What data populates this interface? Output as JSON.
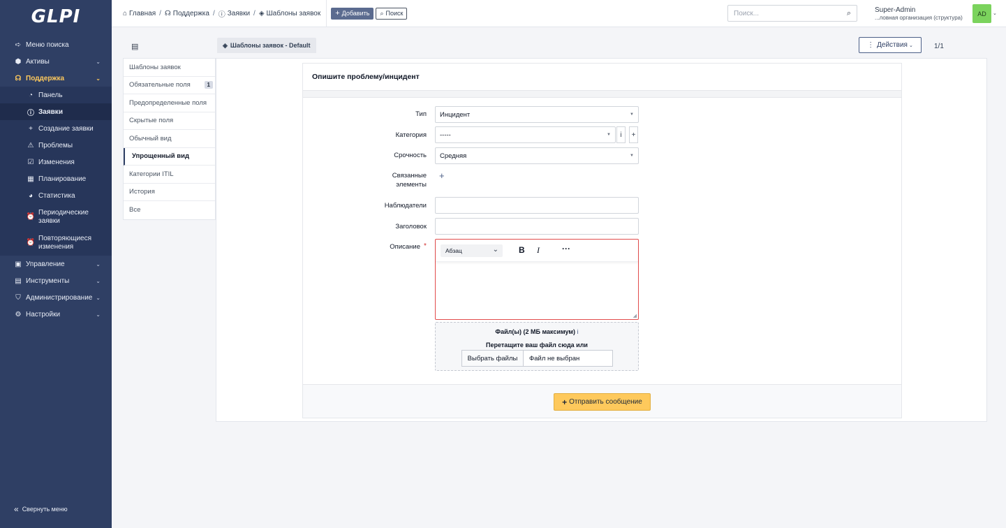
{
  "app": {
    "logo_text": "GLPI",
    "collapse_label": "Свернуть меню"
  },
  "sidebar": {
    "items": [
      {
        "label": "Меню поиска",
        "icon": "arrow-right-icon"
      },
      {
        "label": "Активы",
        "icon": "box-icon"
      },
      {
        "label": "Поддержка",
        "icon": "headset-icon"
      },
      {
        "label": "Управление",
        "icon": "wallet-icon"
      },
      {
        "label": "Инструменты",
        "icon": "briefcase-icon"
      },
      {
        "label": "Администрирование",
        "icon": "shield-icon"
      },
      {
        "label": "Настройки",
        "icon": "gear-icon"
      }
    ],
    "support_sub": [
      {
        "label": "Панель",
        "icon": "dashboard-icon"
      },
      {
        "label": "Заявки",
        "icon": "alert-circle-icon"
      },
      {
        "label": "Создание заявки",
        "icon": "plus-icon"
      },
      {
        "label": "Проблемы",
        "icon": "warning-icon"
      },
      {
        "label": "Изменения",
        "icon": "clipboard-check-icon"
      },
      {
        "label": "Планирование",
        "icon": "calendar-icon"
      },
      {
        "label": "Статистика",
        "icon": "pie-chart-icon"
      },
      {
        "label": "Периодические заявки",
        "icon": "alarm-icon"
      },
      {
        "label": "Повторяющиеся изменения",
        "icon": "alarm-icon"
      }
    ]
  },
  "header": {
    "breadcrumb": [
      "Главная",
      "Поддержка",
      "Заявки",
      "Шаблоны заявок"
    ],
    "add_label": "Добавить",
    "search_label": "Поиск",
    "search_placeholder": "Поиск...",
    "user_name": "Super-Admin",
    "user_org": "...ловная организация (структура)",
    "avatar_initials": "AD"
  },
  "page": {
    "tab_title": "Шаблоны заявок - Default",
    "actions_label": "Действия",
    "pager": "1/1"
  },
  "tabs": [
    {
      "label": "Шаблоны заявок"
    },
    {
      "label": "Обязательные поля",
      "badge": "1"
    },
    {
      "label": "Предопределенные поля"
    },
    {
      "label": "Скрытые поля"
    },
    {
      "label": "Обычный вид"
    },
    {
      "label": "Упрощенный вид"
    },
    {
      "label": "Категории ITIL"
    },
    {
      "label": "История"
    },
    {
      "label": "Все"
    }
  ],
  "form": {
    "title": "Опишите проблему/инцидент",
    "type_label": "Тип",
    "type_value": "Инцидент",
    "category_label": "Категория",
    "category_value": "-----",
    "urgency_label": "Срочность",
    "urgency_value": "Средняя",
    "linked_label_1": "Связанные",
    "linked_label_2": "элементы",
    "observers_label": "Наблюдатели",
    "title_label": "Заголовок",
    "description_label": "Описание",
    "editor_paragraph": "Абзац",
    "files_title": "Файл(ы) (2 МБ максимум)",
    "files_drag": "Перетащите ваш файл сюда или",
    "choose_files": "Выбрать файлы",
    "no_file": "Файл не выбран",
    "submit_label": "Отправить сообщение"
  },
  "colors": {
    "sidebar": "#2f3f64",
    "accent": "#fec95c",
    "required": "#d32f2f",
    "avatar": "#7bd35d"
  }
}
